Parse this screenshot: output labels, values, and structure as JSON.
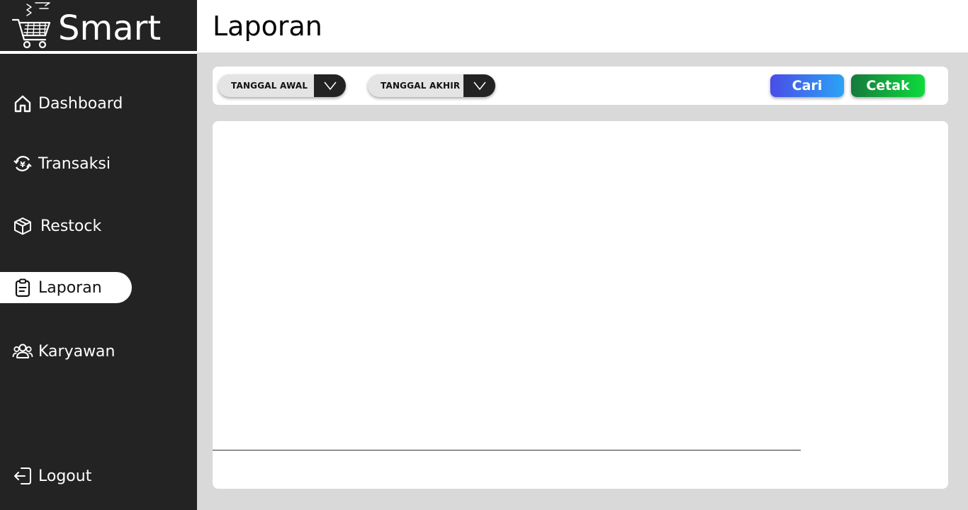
{
  "brand": {
    "name": "Smart",
    "logo_icon": "shopping-cart-icon"
  },
  "sidebar": {
    "items": [
      {
        "label": "Dashboard",
        "icon": "home-icon",
        "active": false
      },
      {
        "label": "Transaksi",
        "icon": "currency-exchange-icon",
        "active": false
      },
      {
        "label": "Restock",
        "icon": "package-icon",
        "active": false
      },
      {
        "label": "Laporan",
        "icon": "clipboard-icon",
        "active": true
      },
      {
        "label": "Karyawan",
        "icon": "users-icon",
        "active": false
      }
    ],
    "logout": {
      "label": "Logout",
      "icon": "logout-icon"
    }
  },
  "header": {
    "title": "Laporan"
  },
  "filters": {
    "start_date": {
      "label": "TANGGAL AWAL",
      "icon": "chevron-down-icon"
    },
    "end_date": {
      "label": "TANGGAL AKHIR",
      "icon": "chevron-down-icon"
    },
    "search_label": "Cari",
    "print_label": "Cetak"
  },
  "colors": {
    "sidebar_bg": "#232323",
    "page_bg": "#d9d9d9",
    "search_gradient": [
      "#4a4de6",
      "#2aa3f6"
    ],
    "print_gradient": [
      "#167a3c",
      "#0ddb3c"
    ]
  }
}
